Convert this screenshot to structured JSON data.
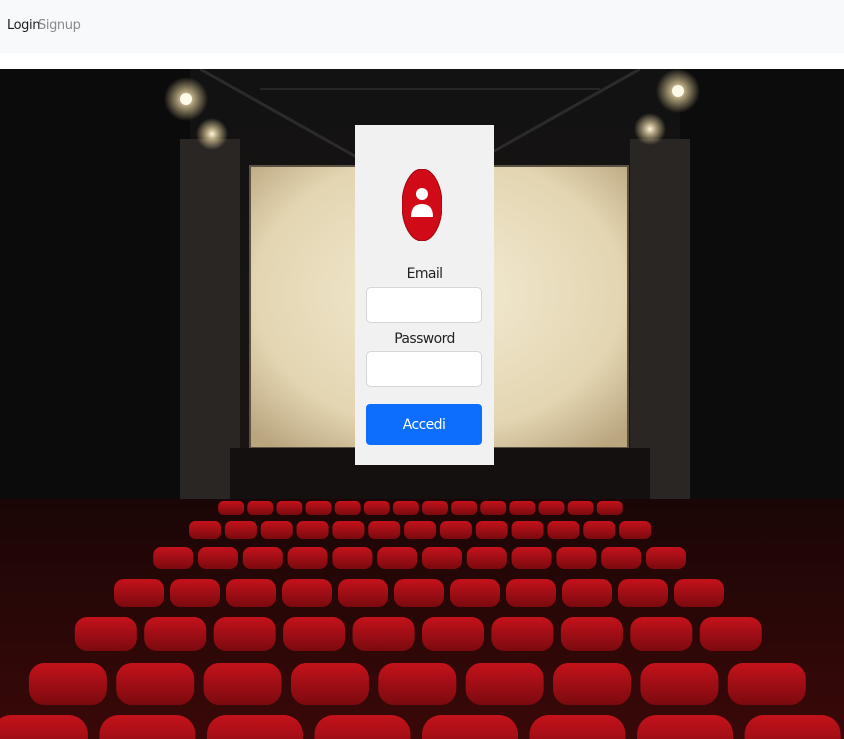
{
  "nav": {
    "login_label": "Login",
    "signup_label": "Signup"
  },
  "login_form": {
    "email_label": "Email",
    "email_value": "",
    "password_label": "Password",
    "password_value": "",
    "submit_label": "Accedi",
    "avatar_icon": "user-avatar-icon"
  },
  "colors": {
    "navbar_bg": "#f8f9fa",
    "card_bg": "#f1f1f1",
    "button_bg": "#0d6efd",
    "avatar_red": "#d10a17"
  },
  "background": {
    "icon": "cinema-theater-image"
  }
}
